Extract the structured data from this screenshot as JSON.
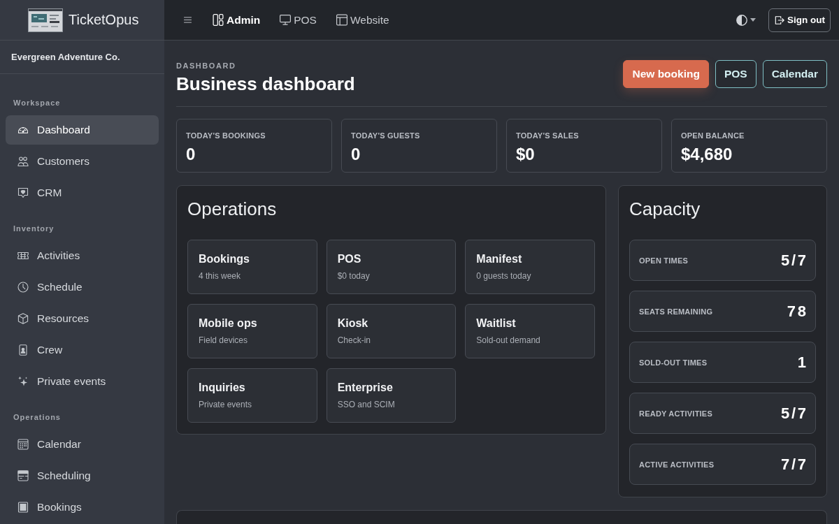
{
  "sidebar": {
    "brand": "TicketOpus",
    "organization": "Evergreen Adventure Co.",
    "sections": [
      {
        "title": "Workspace",
        "items": [
          {
            "label": "Dashboard",
            "selected": true
          },
          {
            "label": "Customers",
            "selected": false
          },
          {
            "label": "CRM",
            "selected": false
          }
        ]
      },
      {
        "title": "Inventory",
        "items": [
          {
            "label": "Activities",
            "selected": false
          },
          {
            "label": "Schedule",
            "selected": false
          },
          {
            "label": "Resources",
            "selected": false
          },
          {
            "label": "Crew",
            "selected": false
          },
          {
            "label": "Private events",
            "selected": false
          }
        ]
      },
      {
        "title": "Operations",
        "items": [
          {
            "label": "Calendar",
            "selected": false
          },
          {
            "label": "Scheduling",
            "selected": false
          },
          {
            "label": "Bookings",
            "selected": false
          }
        ]
      }
    ]
  },
  "topbar": {
    "tabs": [
      {
        "label": "Admin",
        "selected": true
      },
      {
        "label": "POS",
        "selected": false
      },
      {
        "label": "Website",
        "selected": false
      }
    ],
    "theme_menu": {
      "expanded": false
    },
    "sign_out": "Sign out"
  },
  "page_header": {
    "eyebrow": "DASHBOARD",
    "title": "Business dashboard",
    "actions": [
      {
        "label": "New booking",
        "kind": "primary"
      },
      {
        "label": "POS",
        "kind": "outline"
      },
      {
        "label": "Calendar",
        "kind": "outline"
      }
    ]
  },
  "stats": [
    {
      "label": "TODAY'S BOOKINGS",
      "value": "0"
    },
    {
      "label": "TODAY'S GUESTS",
      "value": "0"
    },
    {
      "label": "TODAY'S SALES",
      "value": "$0"
    },
    {
      "label": "OPEN BALANCE",
      "value": "$4,680"
    }
  ],
  "operations": {
    "title": "Operations",
    "tiles": [
      {
        "title": "Bookings",
        "subtitle": "4 this week"
      },
      {
        "title": "POS",
        "subtitle": "$0 today"
      },
      {
        "title": "Manifest",
        "subtitle": "0 guests today"
      },
      {
        "title": "Mobile ops",
        "subtitle": "Field devices"
      },
      {
        "title": "Kiosk",
        "subtitle": "Check-in"
      },
      {
        "title": "Waitlist",
        "subtitle": "Sold-out demand"
      },
      {
        "title": "Inquiries",
        "subtitle": "Private events"
      },
      {
        "title": "Enterprise",
        "subtitle": "SSO and SCIM"
      }
    ]
  },
  "capacity": {
    "title": "Capacity",
    "rows": [
      {
        "label": "OPEN TIMES",
        "value": "5/7"
      },
      {
        "label": "SEATS REMAINING",
        "value": "78"
      },
      {
        "label": "SOLD-OUT TIMES",
        "value": "1"
      },
      {
        "label": "READY ACTIVITIES",
        "value": "5/7"
      },
      {
        "label": "ACTIVE ACTIVITIES",
        "value": "7/7"
      }
    ]
  }
}
